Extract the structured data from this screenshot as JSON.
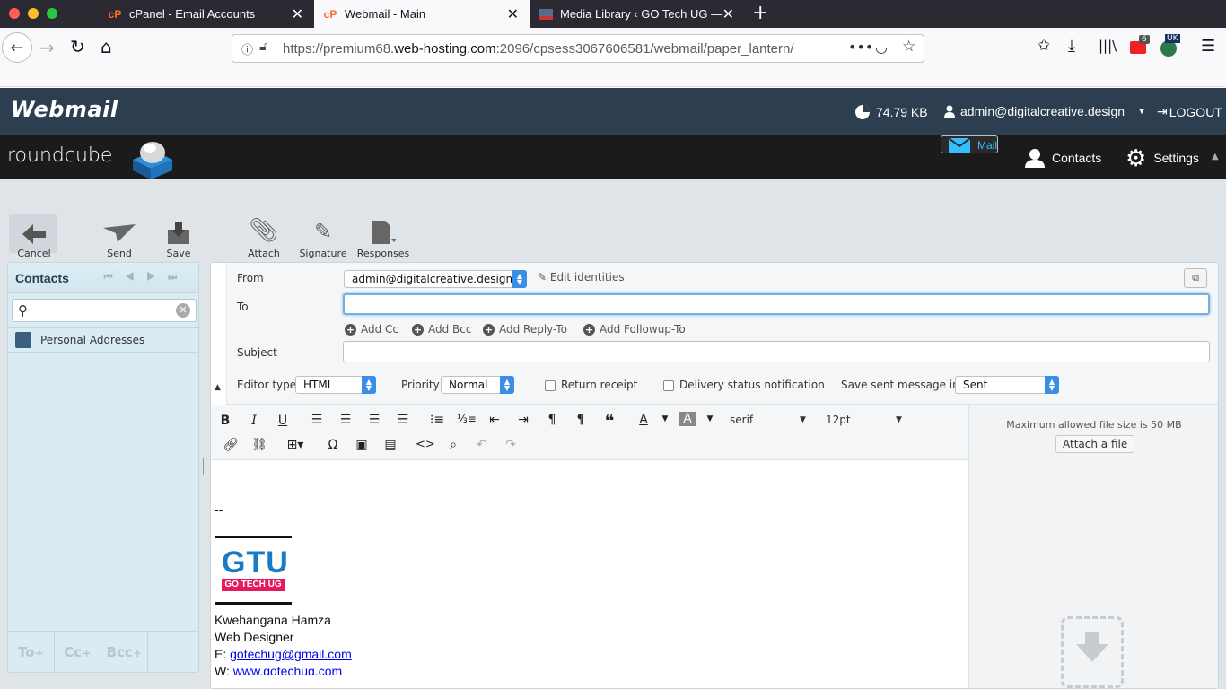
{
  "browser": {
    "tabs": [
      {
        "title": "cPanel - Email Accounts",
        "active": false
      },
      {
        "title": "Webmail - Main",
        "active": true
      },
      {
        "title": "Media Library ‹ GO Tech UG —",
        "active": false
      }
    ],
    "url_prefix": "https://premium68.",
    "url_host": "web-hosting.com",
    "url_rest": ":2096/cpsess3067606581/webmail/paper_lantern/",
    "badge_count": "6",
    "badge_uk": "UK"
  },
  "header": {
    "logo": "Webmail",
    "disk_usage": "74.79 KB",
    "user": "admin@digitalcreative.design",
    "logout": "LOGOUT"
  },
  "roundcube": {
    "logo": "roundcube",
    "nav": [
      {
        "label": "Mail",
        "selected": true
      },
      {
        "label": "Contacts",
        "selected": false
      },
      {
        "label": "Settings",
        "selected": false
      }
    ]
  },
  "toolbar": {
    "cancel": "Cancel",
    "send": "Send",
    "save": "Save",
    "attach": "Attach",
    "signature": "Signature",
    "responses": "Responses"
  },
  "contacts": {
    "title": "Contacts",
    "search_value": "",
    "address_book": "Personal Addresses",
    "footer": [
      "To",
      "Cc",
      "Bcc"
    ]
  },
  "compose": {
    "from_label": "From",
    "from_value": "admin@digitalcreative.design",
    "edit_identities": "Edit identities",
    "to_label": "To",
    "to_value": "",
    "add_links": [
      "Add Cc",
      "Add Bcc",
      "Add Reply-To",
      "Add Followup-To"
    ],
    "subject_label": "Subject",
    "subject_value": "",
    "editor_type_label": "Editor type",
    "editor_type": "HTML",
    "priority_label": "Priority",
    "priority": "Normal",
    "return_receipt": "Return receipt",
    "delivery_notification": "Delivery status notification",
    "save_sent_label": "Save sent message in",
    "save_sent": "Sent"
  },
  "editor": {
    "font": "serif",
    "size": "12pt",
    "sig_sep": "--",
    "logo_text": "GTU",
    "logo_sub": "GO TECH UG",
    "name": "Kwehangana Hamza",
    "role": "Web Designer",
    "email_prefix": "E:",
    "email": "gotechug@gmail.com",
    "web_prefix": "W:",
    "web": "www.gotechug.com"
  },
  "attachments": {
    "max_size": "Maximum allowed file size is 50 MB",
    "attach_button": "Attach a file"
  },
  "colors": {
    "webmail_header": "#2c3e50",
    "roundcube_header": "#1b1b1b",
    "accent": "#37beff",
    "select_arrow": "#3a8ee6",
    "logo_blue": "#1a7ac4",
    "logo_pink": "#e6195c"
  }
}
